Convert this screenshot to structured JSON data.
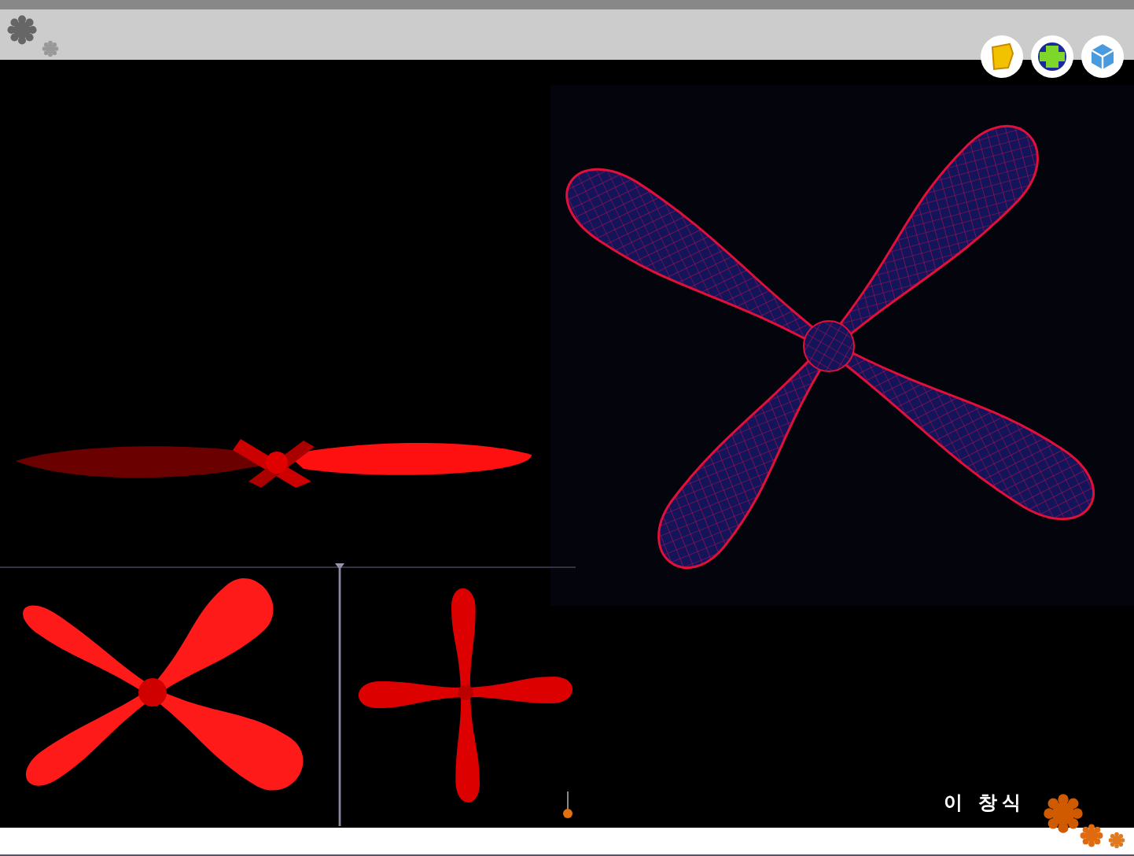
{
  "slide": {
    "author": "이 창식"
  }
}
